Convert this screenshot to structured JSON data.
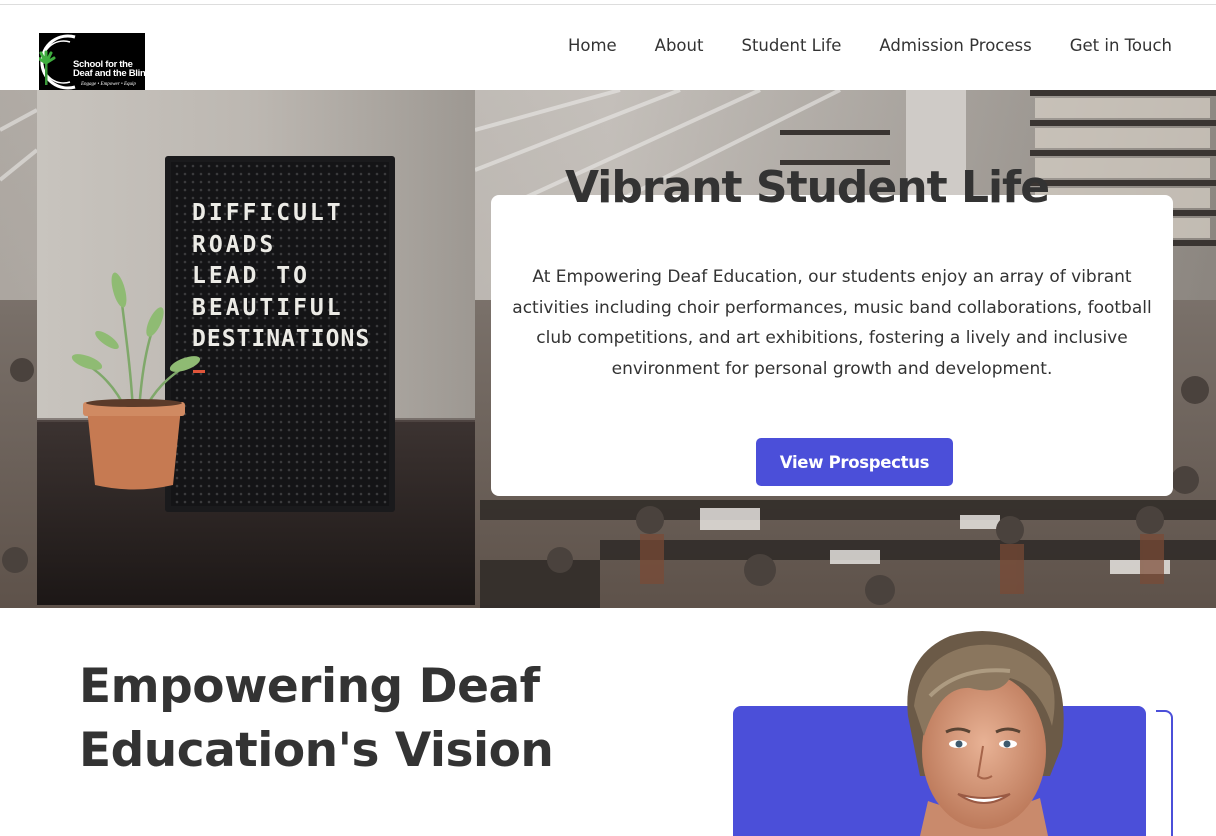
{
  "header": {
    "logo": {
      "line1": "School for the",
      "line2": "Deaf and the Blind",
      "tagline": "Engage • Empower • Equip"
    },
    "nav": [
      "Home",
      "About",
      "Student Life",
      "Admission Process",
      "Get in Touch"
    ]
  },
  "hero": {
    "title": "Vibrant Student Life",
    "text": "At Empowering Deaf Education, our students enjoy an array of vibrant activities including choir performances, music band collaborations, football club competitions, and art exhibitions, fostering a lively and inclusive environment for personal growth and development.",
    "button_label": "View Prospectus",
    "letterboard": [
      "DIFFICULT",
      "ROADS",
      "LEAD TO",
      "BEAUTIFUL",
      "DESTINATIONS"
    ]
  },
  "vision": {
    "title": "Empowering Deaf Education's Vision"
  },
  "colors": {
    "accent": "#4b4fd9",
    "text": "#333333",
    "card": "#ffffff"
  }
}
